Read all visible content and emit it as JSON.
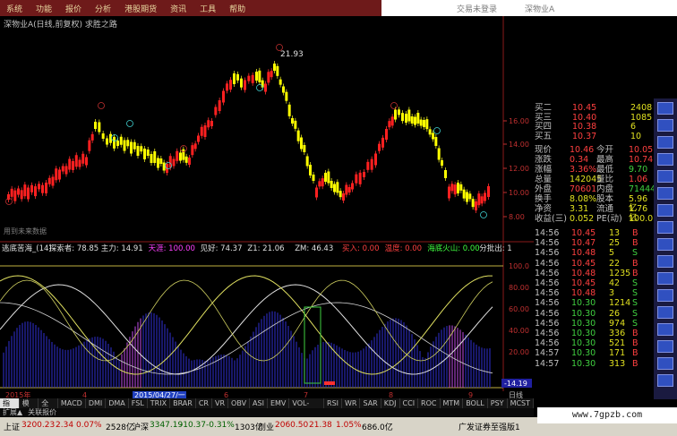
{
  "menu": [
    "系统",
    "功能",
    "报价",
    "分析",
    "港股期货",
    "资讯",
    "工具",
    "帮助"
  ],
  "titlebar": {
    "left": "交易未登录",
    "right": "深物业A"
  },
  "stock_line": "深物业A(日线,前复权) 求胜之路",
  "price_axis": [
    "16.00",
    "14.00",
    "12.00",
    "10.00",
    "8.00"
  ],
  "annotations": {
    "high": "21.93",
    "future": "用到未来数据",
    "cursor": "-14.19"
  },
  "indicator_line": [
    {
      "t": "逃底苦海_(14)",
      "c": "#e0e0e0"
    },
    {
      "t": "探索者: 78.85",
      "c": "#e0e0e0"
    },
    {
      "t": "主力: 14.91",
      "c": "#e0e0e0"
    },
    {
      "t": "天涯: 100.00",
      "c": "#ff40ff"
    },
    {
      "t": "见好: 74.37",
      "c": "#e0e0e0"
    },
    {
      "t": "Z1: 21.06",
      "c": "#e0e0e0"
    },
    {
      "t": "ZM: 46.43",
      "c": "#e0e0e0"
    },
    {
      "t": "买入: 0.00",
      "c": "#ff4040"
    },
    {
      "t": "温度: 0.00",
      "c": "#ff4040"
    },
    {
      "t": "海底火山: 0.00",
      "c": "#40ff40"
    },
    {
      "t": "分批出: 1",
      "c": "#e0e0e0"
    }
  ],
  "ind_axis": [
    "100.0",
    "80.00",
    "60.00",
    "40.00",
    "20.00"
  ],
  "date_axis": {
    "year": "2015年",
    "marks": [
      "4",
      "5",
      "6",
      "7",
      "8",
      "9"
    ],
    "cursor_date": "2015/04/27/一",
    "period": "日线"
  },
  "tabs": [
    "指标",
    "模板",
    "全部",
    "MACD",
    "DMI",
    "DMA",
    "FSL",
    "TRIX",
    "BRAR",
    "CR",
    "VR",
    "OBV",
    "ASI",
    "EMV",
    "VOL-TDX",
    "RSI",
    "WR",
    "SAR",
    "KDJ",
    "CCI",
    "ROC",
    "MTM",
    "BOLL",
    "PSY",
    "MCST"
  ],
  "tabs2": [
    "扩展▲",
    "关联报价"
  ],
  "orderbook": [
    {
      "label": "买二",
      "price": "10.45",
      "vol": "2408"
    },
    {
      "label": "买三",
      "price": "10.40",
      "vol": "1085"
    },
    {
      "label": "买四",
      "price": "10.38",
      "vol": "6"
    },
    {
      "label": "买五",
      "price": "10.37",
      "vol": "10"
    }
  ],
  "stats": [
    [
      "现价",
      "10.46",
      "今开",
      "10.05"
    ],
    [
      "涨跌",
      "0.34",
      "最高",
      "10.74"
    ],
    [
      "涨幅",
      "3.36%",
      "最低",
      "9.70"
    ],
    [
      "总量",
      "142045",
      "量比",
      "1.06"
    ],
    [
      "外盘",
      "70601",
      "内盘",
      "71444"
    ],
    [
      "换手",
      "8.08%",
      "股本",
      "5.96亿"
    ],
    [
      "净资",
      "3.31",
      "流通",
      "1.76亿"
    ],
    [
      "收益(三)",
      "0.052",
      "PE(动)",
      "100.0"
    ]
  ],
  "ticks": [
    [
      "14:56",
      "10.45",
      "13",
      "B"
    ],
    [
      "14:56",
      "10.47",
      "25",
      "B"
    ],
    [
      "14:56",
      "10.48",
      "5",
      "S"
    ],
    [
      "14:56",
      "10.45",
      "22",
      "B"
    ],
    [
      "14:56",
      "10.48",
      "1235",
      "B"
    ],
    [
      "14:56",
      "10.45",
      "42",
      "S"
    ],
    [
      "14:56",
      "10.48",
      "3",
      "S"
    ],
    [
      "14:56",
      "10.30",
      "1214",
      "S"
    ],
    [
      "14:56",
      "10.30",
      "26",
      "S"
    ],
    [
      "14:56",
      "10.30",
      "974",
      "S"
    ],
    [
      "14:56",
      "10.30",
      "336",
      "B"
    ],
    [
      "14:56",
      "10.30",
      "521",
      "B"
    ],
    [
      "14:57",
      "10.30",
      "171",
      "B"
    ],
    [
      "14:57",
      "10.30",
      "313",
      "B"
    ]
  ],
  "status": {
    "sh": "上证",
    "sh_val": "3200.23",
    "sh_chg": "2.34",
    "sh_pct": "0.07%",
    "sh_amt": "2528亿",
    "hs": "沪深",
    "hs_val": "3347.19",
    "hs_chg": "-10.37",
    "hs_pct": "-0.31%",
    "hs_amt": "1303亿",
    "cy": "创业",
    "cy_val": "2060.50",
    "cy_chg": "21.38",
    "cy_pct": "1.05%",
    "cy_amt": "686.0亿",
    "news": "广发证券至强版1"
  },
  "watermark": "www.7gpzb.com"
}
